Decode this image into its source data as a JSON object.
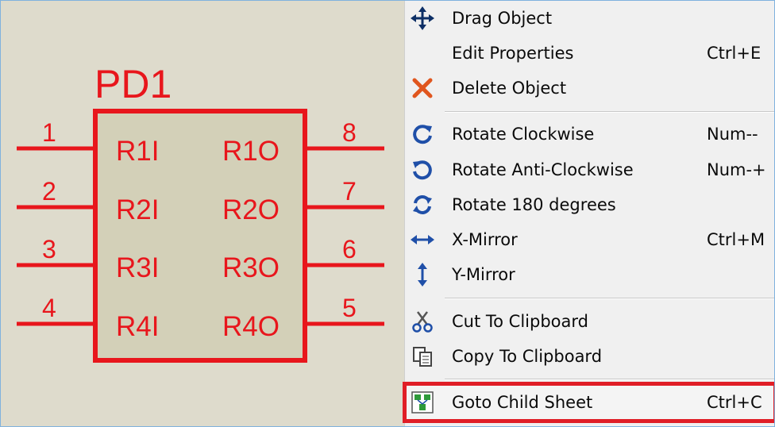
{
  "schematic": {
    "component_ref": "PD1",
    "pins_left": [
      {
        "number": "1",
        "name": "R1I"
      },
      {
        "number": "2",
        "name": "R2I"
      },
      {
        "number": "3",
        "name": "R3I"
      },
      {
        "number": "4",
        "name": "R4I"
      }
    ],
    "pins_right": [
      {
        "number": "8",
        "name": "R1O"
      },
      {
        "number": "7",
        "name": "R2O"
      },
      {
        "number": "6",
        "name": "R3O"
      },
      {
        "number": "5",
        "name": "R4O"
      }
    ]
  },
  "menu": {
    "items": [
      {
        "id": "drag-object",
        "label": "Drag Object",
        "shortcut": "",
        "icon": "move-arrows-icon"
      },
      {
        "id": "edit-properties",
        "label": "Edit Properties",
        "shortcut": "Ctrl+E",
        "icon": ""
      },
      {
        "id": "delete-object",
        "label": "Delete Object",
        "shortcut": "",
        "icon": "delete-x-icon"
      },
      {
        "id": "rotate-clockwise",
        "label": "Rotate Clockwise",
        "shortcut": "Num--",
        "icon": "rotate-cw-icon"
      },
      {
        "id": "rotate-anticlockwise",
        "label": "Rotate Anti-Clockwise",
        "shortcut": "Num-+",
        "icon": "rotate-ccw-icon"
      },
      {
        "id": "rotate-180",
        "label": "Rotate 180 degrees",
        "shortcut": "",
        "icon": "rotate-180-icon"
      },
      {
        "id": "x-mirror",
        "label": "X-Mirror",
        "shortcut": "Ctrl+M",
        "icon": "x-mirror-icon"
      },
      {
        "id": "y-mirror",
        "label": "Y-Mirror",
        "shortcut": "",
        "icon": "y-mirror-icon"
      },
      {
        "id": "cut-to-clipboard",
        "label": "Cut To Clipboard",
        "shortcut": "",
        "icon": "scissors-icon"
      },
      {
        "id": "copy-to-clipboard",
        "label": "Copy To Clipboard",
        "shortcut": "",
        "icon": "copy-icon"
      },
      {
        "id": "goto-child-sheet",
        "label": "Goto Child Sheet",
        "shortcut": "Ctrl+C",
        "icon": "child-sheet-icon"
      }
    ]
  },
  "colors": {
    "schematic_red": "#e8161c",
    "canvas_bg": "#dedbcc",
    "menu_bg": "#f0f0f0",
    "icon_blue": "#1f4fa8",
    "highlight_red": "#e01e26"
  }
}
